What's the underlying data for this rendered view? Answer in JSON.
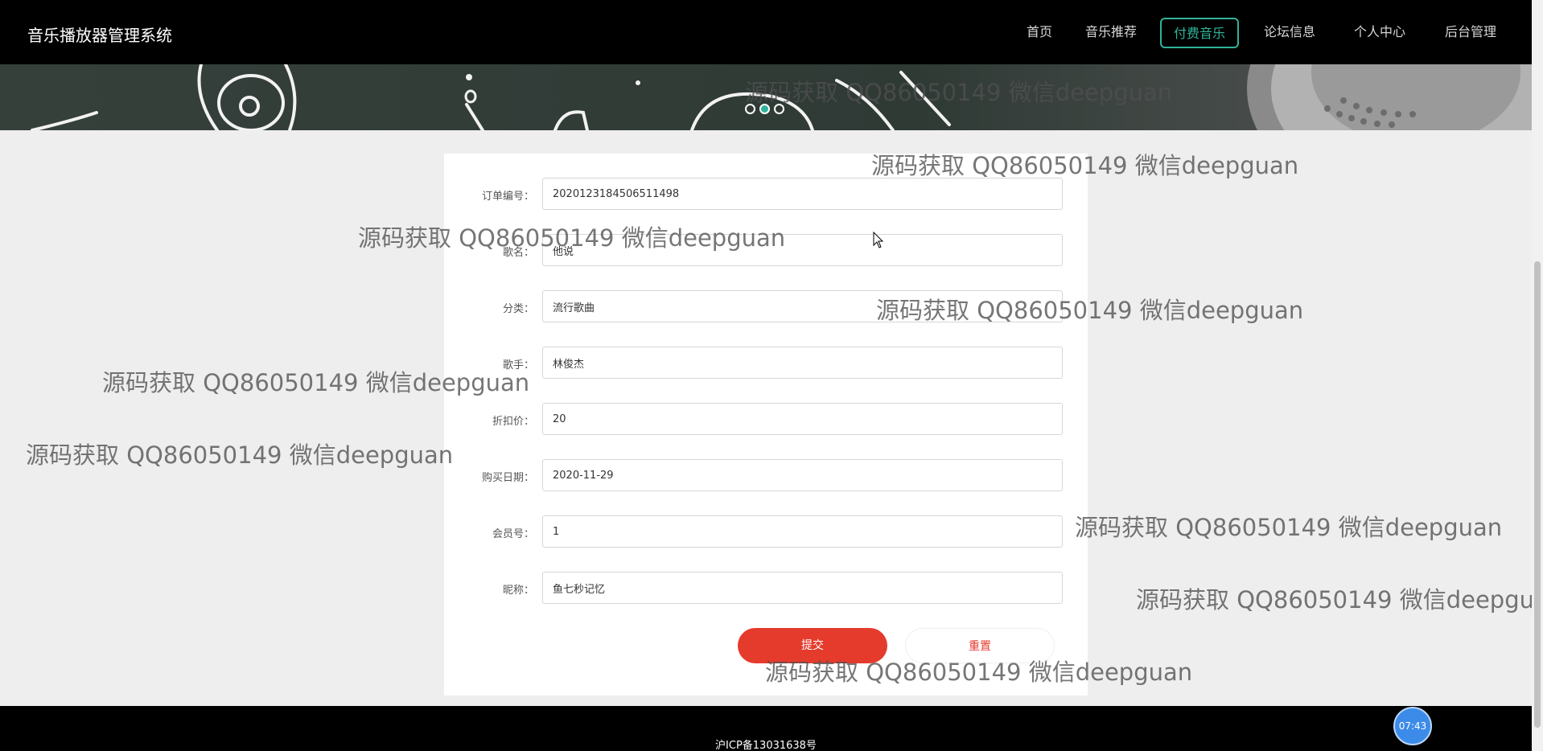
{
  "app": {
    "title": "音乐播放器管理系统"
  },
  "nav": {
    "items": [
      "首页",
      "音乐推荐",
      "付费音乐",
      "论坛信息",
      "个人中心",
      "后台管理"
    ],
    "active_index": 2
  },
  "banner": {
    "slide_count": 3,
    "active_slide": 2
  },
  "form": {
    "fields": [
      {
        "label": "订单编号：",
        "value": "2020123184506511498"
      },
      {
        "label": "歌名：",
        "value": "他说"
      },
      {
        "label": "分类：",
        "value": "流行歌曲"
      },
      {
        "label": "歌手：",
        "value": "林俊杰"
      },
      {
        "label": "折扣价：",
        "value": "20"
      },
      {
        "label": "购买日期：",
        "value": "2020-11-29"
      },
      {
        "label": "会员号：",
        "value": "1"
      },
      {
        "label": "昵称：",
        "value": "鱼七秒记忆"
      }
    ],
    "submit_label": "提交",
    "reset_label": "重置"
  },
  "footer": {
    "icp": "沪ICP备13031638号"
  },
  "clock": {
    "time": "07:43"
  },
  "watermark": {
    "text": "源码获取 QQ86050149 微信deepguan"
  },
  "colors": {
    "accent": "#2fb39a",
    "danger": "#e53b2c",
    "nav_bg": "#000000"
  }
}
